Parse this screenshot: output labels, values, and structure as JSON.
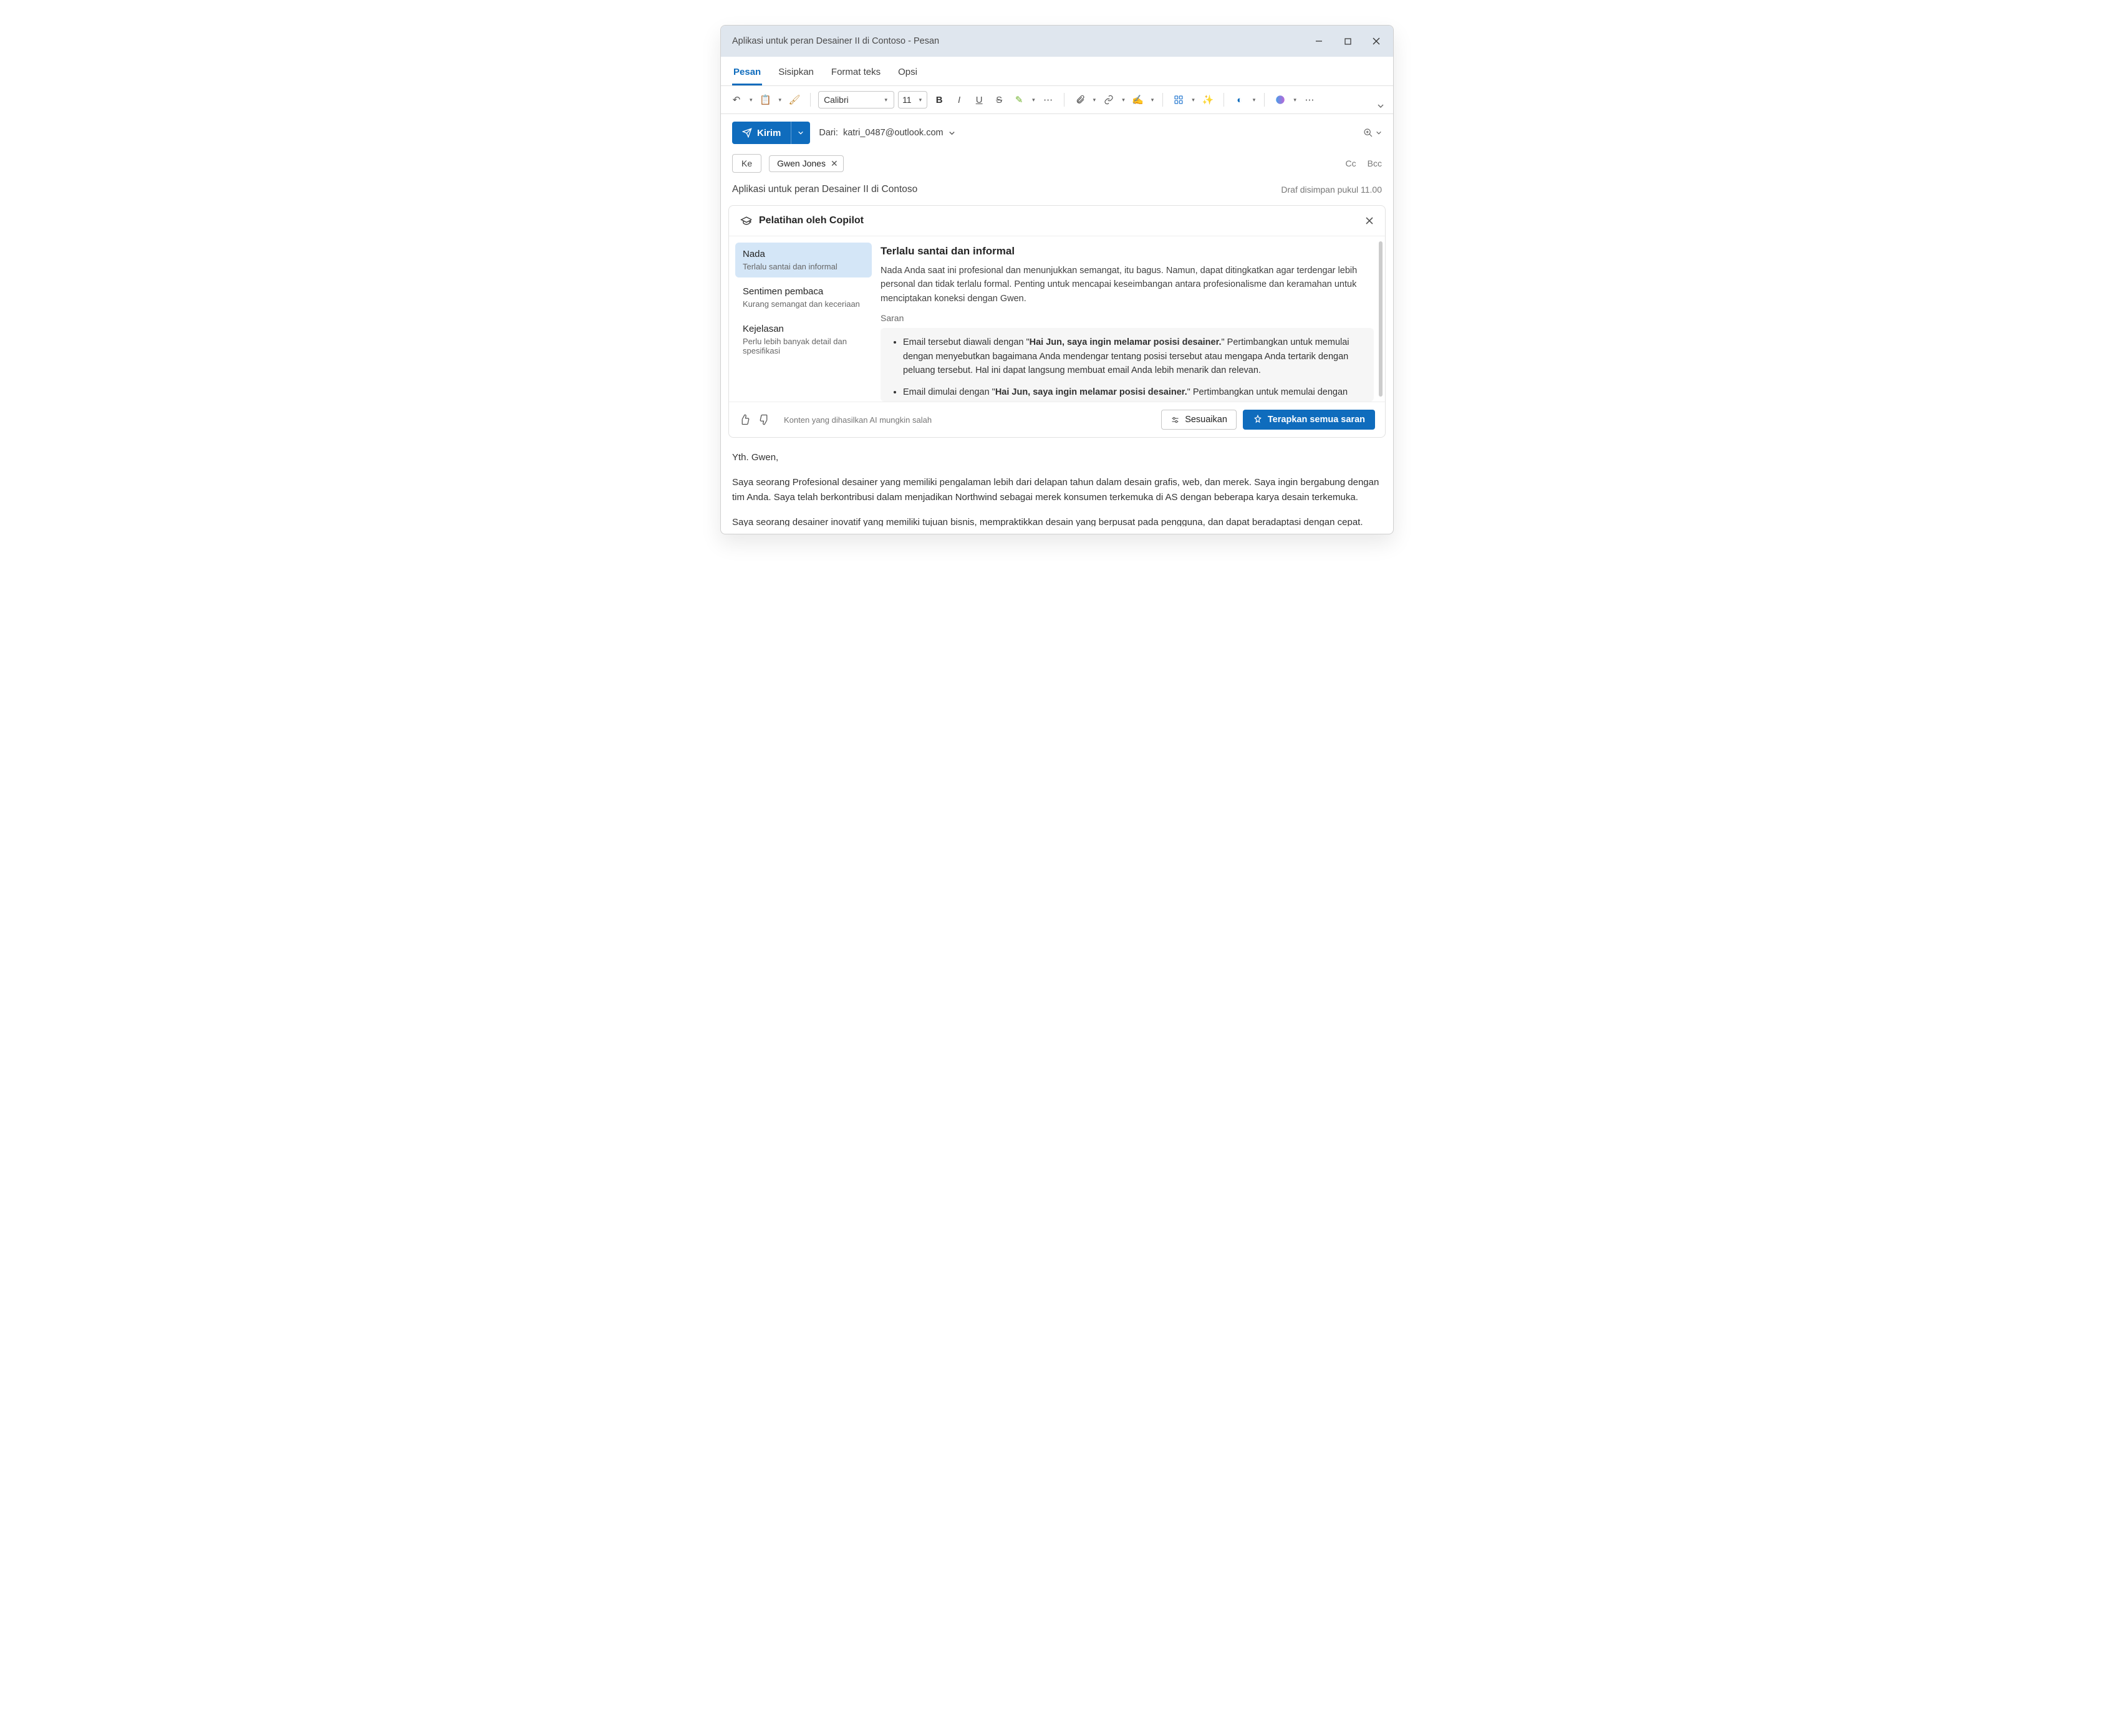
{
  "window": {
    "title": "Aplikasi untuk peran Desainer II di Contoso - Pesan"
  },
  "menuTabs": {
    "t0": "Pesan",
    "t1": "Sisipkan",
    "t2": "Format teks",
    "t3": "Opsi"
  },
  "ribbon": {
    "fontName": "Calibri",
    "fontSize": "11"
  },
  "send": {
    "label": "Kirim",
    "fromPrefix": "Dari:",
    "fromEmail": "katri_0487@outlook.com"
  },
  "to": {
    "button": "Ke",
    "recipient": "Gwen Jones",
    "cc": "Cc",
    "bcc": "Bcc"
  },
  "subject": {
    "text": "Aplikasi untuk peran Desainer II di Contoso",
    "draft": "Draf disimpan pukul 11.00"
  },
  "copilot": {
    "title": "Pelatihan oleh Copilot",
    "side": {
      "i0t": "Nada",
      "i0s": "Terlalu santai dan informal",
      "i1t": "Sentimen pembaca",
      "i1s": "Kurang semangat dan keceriaan",
      "i2t": "Kejelasan",
      "i2s": "Perlu lebih banyak detail dan spesifikasi"
    },
    "main": {
      "heading": "Terlalu santai dan informal",
      "para": "Nada Anda saat ini profesional dan menunjukkan semangat, itu bagus. Namun, dapat ditingkatkan agar terdengar lebih personal dan tidak terlalu formal. Penting untuk mencapai keseimbangan antara profesionalisme dan keramahan untuk menciptakan koneksi dengan Gwen.",
      "saran": "Saran",
      "sug1a": "Email tersebut diawali dengan \"",
      "sug1b": "Hai Jun, saya ingin melamar posisi desainer.",
      "sug1c": "\" Pertimbangkan untuk memulai dengan menyebutkan bagaimana Anda mendengar tentang posisi tersebut atau mengapa Anda tertarik dengan peluang tersebut. Hal ini dapat langsung membuat email Anda lebih menarik dan relevan.",
      "sug2a": "Email dimulai dengan \"",
      "sug2b": "Hai Jun, saya ingin melamar posisi desainer.",
      "sug2c": "\" Pertimbangkan untuk memulai dengan"
    },
    "footer": {
      "disclaim": "Konten yang dihasilkan AI mungkin salah",
      "customize": "Sesuaikan",
      "apply": "Terapkan semua saran"
    }
  },
  "body": {
    "p0": "Yth. Gwen,",
    "p1": "Saya seorang Profesional desainer yang memiliki pengalaman lebih dari delapan tahun dalam desain grafis, web, dan merek. Saya ingin bergabung dengan tim Anda. Saya telah berkontribusi dalam menjadikan Northwind sebagai merek konsumen terkemuka di AS dengan beberapa karya desain terkemuka.",
    "p2": "Saya seorang desainer inovatif yang memiliki tujuan bisnis, mempraktikkan desain yang berpusat pada pengguna, dan dapat beradaptasi dengan cepat. Pendekatan saya menggabungkan tujuan bisnis dengan desain yang berpusat pada pengguna dan kemampuan beradaptasi. Saya sangat antusias tentang"
  }
}
